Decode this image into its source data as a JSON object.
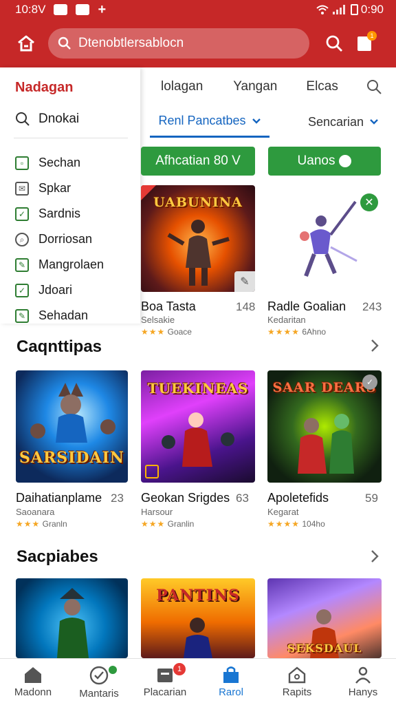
{
  "status_bar": {
    "time": "10:8V",
    "right_time": "0:90"
  },
  "app_bar": {
    "search_text": "Dtenobtlersablocn",
    "notification_count": "1"
  },
  "drawer": {
    "title": "Nadagan",
    "search_label": "Dnokai",
    "items": [
      {
        "label": "Sechan"
      },
      {
        "label": "Spkar"
      },
      {
        "label": "Sardnis"
      },
      {
        "label": "Dorriosan"
      },
      {
        "label": "Mangrolaen"
      },
      {
        "label": "Jdoari"
      },
      {
        "label": "Sehadan"
      }
    ]
  },
  "tabs": [
    "lolagan",
    "Yangan",
    "Elcas"
  ],
  "filters": {
    "active": "Renl Pancatbes",
    "second": "Sencarian"
  },
  "buttons": {
    "primary": "Afhcatian 80 V",
    "secondary": "Uanos"
  },
  "featured": [
    {
      "art_title": "UABUNINA",
      "name": "Boa Tasta",
      "num": "148",
      "sub": "Selsakie",
      "stars": "★★★",
      "rating_text": "Goace"
    },
    {
      "name": "Radle Goalian",
      "num": "243",
      "sub": "Kedaritan",
      "stars": "★★★★",
      "rating_text": "6Ahno"
    }
  ],
  "sections": [
    {
      "title": "Caqnttipas",
      "cards": [
        {
          "art_title": "SARSIDAIN",
          "name": "Daihatianplame",
          "num": "23",
          "sub": "Saoanara",
          "stars": "★★★",
          "rating_text": "Granln"
        },
        {
          "art_title": "TUEKINEAS",
          "name": "Geokan Srigdes",
          "num": "63",
          "sub": "Harsour",
          "stars": "★★★",
          "rating_text": "Granlin"
        },
        {
          "art_title": "SAAR DEARS",
          "name": "Apoletefids",
          "num": "59",
          "sub": "Kegarat",
          "stars": "★★★★",
          "rating_text": "104ho"
        }
      ]
    },
    {
      "title": "Sacpiabes",
      "cards": [
        {
          "art_title": ""
        },
        {
          "art_title": "PANTINS"
        },
        {
          "art_title": "SEKSDAUL"
        }
      ]
    }
  ],
  "bottom_nav": [
    {
      "label": "Madonn",
      "icon": "home-icon"
    },
    {
      "label": "Mantaris",
      "icon": "check-circle-icon"
    },
    {
      "label": "Placarian",
      "icon": "store-icon",
      "badge": "1"
    },
    {
      "label": "Rarol",
      "icon": "bag-icon",
      "active": true
    },
    {
      "label": "Rapits",
      "icon": "house-outline-icon"
    },
    {
      "label": "Hanys",
      "icon": "person-icon"
    }
  ],
  "colors": {
    "brand": "#c62828",
    "accent_green": "#2e9a3e",
    "tab_blue": "#1565c0"
  }
}
